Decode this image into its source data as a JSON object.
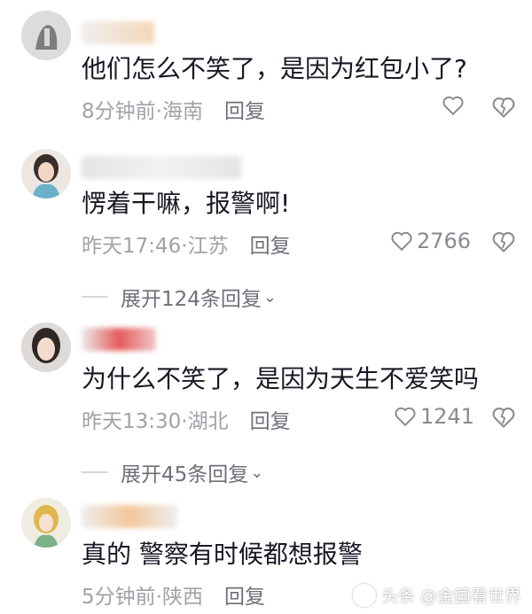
{
  "comments": [
    {
      "text": "他们怎么不笑了，是因为红包小了?",
      "time_location": "8分钟前·海南",
      "reply_label": "回复",
      "likes": ""
    },
    {
      "text": "愣着干嘛，报警啊!",
      "time_location": "昨天17:46·江苏",
      "reply_label": "回复",
      "likes": "2766",
      "expand_label": "展开124条回复"
    },
    {
      "text": "为什么不笑了，是因为天生不爱笑吗",
      "time_location": "昨天13:30·湖北",
      "reply_label": "回复",
      "likes": "1241",
      "expand_label": "展开45条回复"
    },
    {
      "text": "真的 警察有时候都想报警",
      "time_location": "5分钟前·陕西",
      "reply_label": "回复"
    }
  ],
  "watermark": "头条 @金国看世界",
  "colors": {
    "text": "#161823",
    "meta": "#a0a2a7",
    "reply": "#6e7079"
  },
  "icons": [
    "heart-outline-icon",
    "broken-heart-icon",
    "chevron-down-icon"
  ]
}
